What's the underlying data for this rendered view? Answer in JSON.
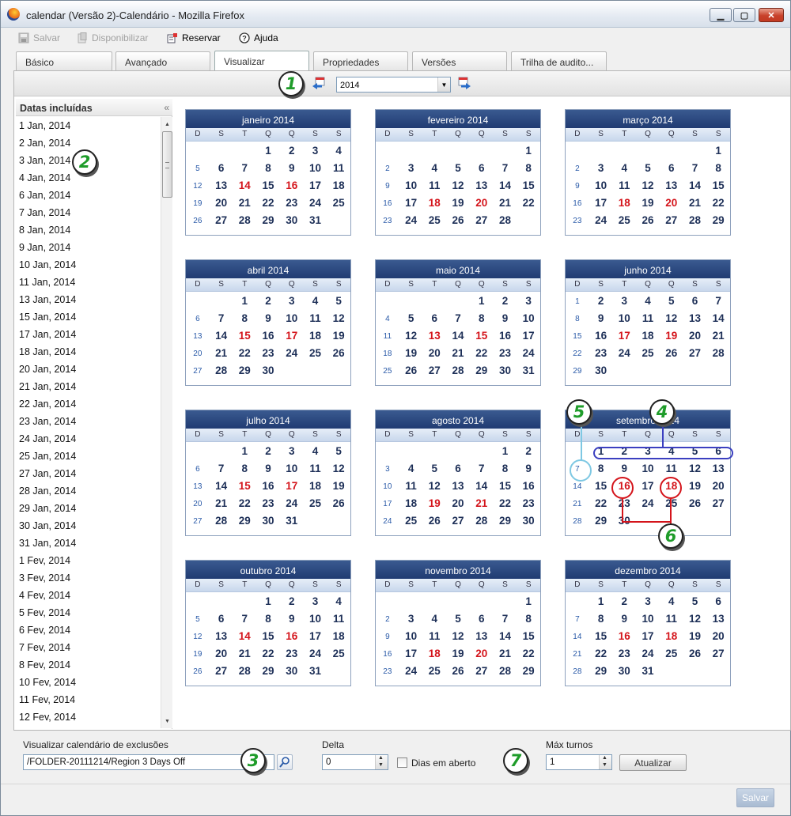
{
  "window": {
    "title": "calendar (Versão 2)-Calendário - Mozilla Firefox"
  },
  "toolbar": {
    "save": "Salvar",
    "publish": "Disponibilizar",
    "reserve": "Reservar",
    "help": "Ajuda"
  },
  "tabs": [
    {
      "label": "Básico"
    },
    {
      "label": "Avançado"
    },
    {
      "label": "Visualizar"
    },
    {
      "label": "Propriedades"
    },
    {
      "label": "Versões"
    },
    {
      "label": "Trilha de audito..."
    }
  ],
  "year_select": {
    "value": "2014"
  },
  "included_dates": {
    "title": "Datas incluídas",
    "items": [
      "1 Jan, 2014",
      "2 Jan, 2014",
      "3 Jan, 2014",
      "4 Jan, 2014",
      "6 Jan, 2014",
      "7 Jan, 2014",
      "8 Jan, 2014",
      "9 Jan, 2014",
      "10 Jan, 2014",
      "11 Jan, 2014",
      "13 Jan, 2014",
      "15 Jan, 2014",
      "17 Jan, 2014",
      "18 Jan, 2014",
      "20 Jan, 2014",
      "21 Jan, 2014",
      "22 Jan, 2014",
      "23 Jan, 2014",
      "24 Jan, 2014",
      "25 Jan, 2014",
      "27 Jan, 2014",
      "28 Jan, 2014",
      "29 Jan, 2014",
      "30 Jan, 2014",
      "31 Jan, 2014",
      "1 Fev, 2014",
      "3 Fev, 2014",
      "4 Fev, 2014",
      "5 Fev, 2014",
      "6 Fev, 2014",
      "7 Fev, 2014",
      "8 Fev, 2014",
      "10 Fev, 2014",
      "11 Fev, 2014",
      "12 Fev, 2014"
    ]
  },
  "weekday_headers": [
    "D",
    "S",
    "T",
    "Q",
    "Q",
    "S",
    "S"
  ],
  "months": [
    {
      "title": "janeiro 2014",
      "offset": 3,
      "days": 31,
      "wn": [
        "",
        5,
        12,
        19,
        26
      ],
      "holidays": [
        14,
        16
      ]
    },
    {
      "title": "fevereiro 2014",
      "offset": 6,
      "days": 28,
      "wn": [
        "",
        2,
        9,
        16,
        23
      ],
      "holidays": [
        18,
        20
      ]
    },
    {
      "title": "março 2014",
      "offset": 6,
      "days": 31,
      "wn": [
        "",
        2,
        9,
        16,
        23
      ],
      "holidays": [
        18,
        20
      ]
    },
    {
      "title": "abril 2014",
      "offset": 2,
      "days": 30,
      "wn": [
        "",
        6,
        13,
        20,
        27
      ],
      "holidays": [
        15,
        17
      ]
    },
    {
      "title": "maio 2014",
      "offset": 4,
      "days": 31,
      "wn": [
        "",
        4,
        11,
        18,
        25
      ],
      "holidays": [
        13,
        15
      ]
    },
    {
      "title": "junho 2014",
      "offset": 0,
      "days": 30,
      "wn": [
        1,
        8,
        15,
        22,
        29
      ],
      "holidays": [
        17,
        19
      ]
    },
    {
      "title": "julho 2014",
      "offset": 2,
      "days": 31,
      "wn": [
        "",
        6,
        13,
        20,
        27
      ],
      "holidays": [
        15,
        17
      ]
    },
    {
      "title": "agosto 2014",
      "offset": 5,
      "days": 31,
      "wn": [
        "",
        3,
        10,
        17,
        24
      ],
      "holidays": [
        19,
        21
      ]
    },
    {
      "title": "setembro 2014",
      "offset": 1,
      "days": 30,
      "wn": [
        "",
        7,
        14,
        21,
        28
      ],
      "holidays": [
        16,
        18
      ]
    },
    {
      "title": "outubro 2014",
      "offset": 3,
      "days": 31,
      "wn": [
        "",
        5,
        12,
        19,
        26
      ],
      "holidays": [
        14,
        16
      ]
    },
    {
      "title": "novembro 2014",
      "offset": 6,
      "days": 30,
      "wn": [
        "",
        2,
        9,
        16,
        23
      ],
      "holidays": [
        18,
        20
      ]
    },
    {
      "title": "dezembro 2014",
      "offset": 1,
      "days": 31,
      "wn": [
        "",
        7,
        14,
        21,
        28
      ],
      "holidays": [
        16,
        18
      ]
    }
  ],
  "bottom": {
    "exclusions_label": "Visualizar calendário de exclusões",
    "exclusions_value": "/FOLDER-20111214/Region 3 Days Off",
    "delta_label": "Delta",
    "delta_value": "0",
    "open_days_label": "Dias em aberto",
    "max_turns_label": "Máx turnos",
    "max_turns_value": "1",
    "update_button": "Atualizar",
    "save_button": "Salvar"
  },
  "callouts": [
    "1",
    "2",
    "3",
    "4",
    "5",
    "6",
    "7"
  ],
  "colors": {
    "header": "#203b72",
    "holiday": "#d4141b",
    "weeknum": "#2a5aa8",
    "callout_green": "#1f9c2a",
    "annot_blue": "#3b3fc0",
    "annot_light": "#7ec8e3",
    "annot_red": "#d4141b"
  }
}
